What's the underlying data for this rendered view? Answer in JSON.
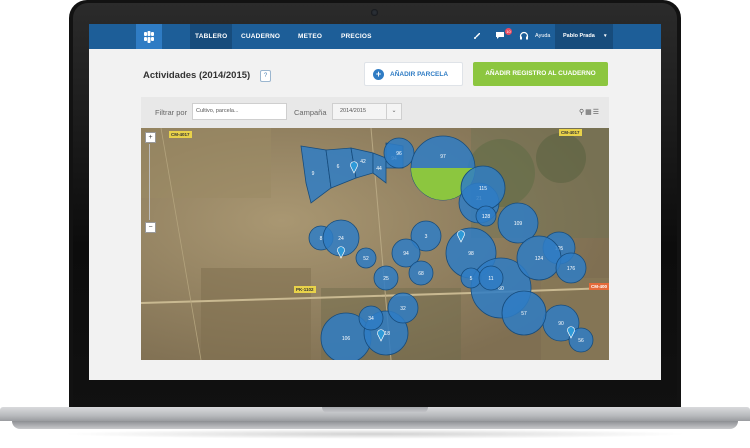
{
  "nav": {
    "items": [
      {
        "label": "TABLERO",
        "active": true
      },
      {
        "label": "CUADERNO",
        "active": false
      },
      {
        "label": "METEO",
        "active": false
      },
      {
        "label": "PRECIOS",
        "active": false
      }
    ],
    "notification_count": "10",
    "help_label": "Ayuda",
    "user_name": "Pablo Prada",
    "icons": [
      "logo-icon",
      "rocket-icon",
      "chat-icon",
      "headset-icon",
      "chevron-down-icon"
    ],
    "colors": {
      "nav_bg": "#1d5e98",
      "active_bg": "#174c7c",
      "accent": "#2f7cc4"
    }
  },
  "header": {
    "title": "Actividades (2014/2015)",
    "help_button": "?",
    "add_parcel_label": "AÑADIR PARCELA",
    "add_record_label": "AÑADIR REGISTRO AL CUADERNO",
    "colors": {
      "add_record_bg": "#8cc63f"
    }
  },
  "filters": {
    "filter_label": "Filtrar por",
    "filter_placeholder": "Cultivo, parcela...",
    "campaign_label": "Campaña",
    "campaign_value": "2014/2015",
    "view_icons": [
      "map-pin-icon",
      "grid-icon",
      "list-icon"
    ]
  },
  "map": {
    "zoom_in": "+",
    "zoom_out": "−",
    "road_labels": [
      "CM-4017",
      "CM-4017",
      "PK-1102",
      "CM-400"
    ],
    "parcel_labels": [
      "9",
      "6",
      "42",
      "44",
      "94",
      "8",
      "96",
      "97",
      "21",
      "98",
      "115",
      "128",
      "60",
      "109",
      "105",
      "3",
      "5",
      "124",
      "11",
      "176",
      "24",
      "52",
      "25",
      "94",
      "68",
      "106",
      "118",
      "32",
      "34",
      "90",
      "56",
      "57"
    ],
    "colors": {
      "parcel_fill": "#2f7cc4",
      "parcel_highlight": "#8cc63f"
    }
  }
}
